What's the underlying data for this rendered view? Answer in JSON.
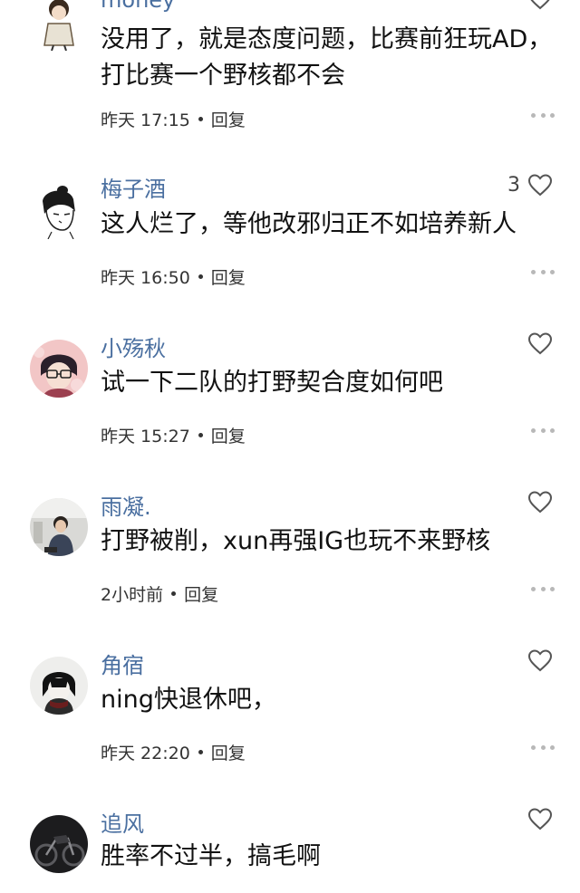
{
  "comments": [
    {
      "username": "money",
      "likes": "",
      "text": "没用了，就是态度问题，比赛前狂玩AD，打比赛一个野核都不会",
      "time": "昨天 17:15",
      "reply": "回复"
    },
    {
      "username": "梅子酒",
      "likes": "3",
      "text": "这人烂了，等他改邪归正不如培养新人",
      "time": "昨天 16:50",
      "reply": "回复"
    },
    {
      "username": "小殇秋",
      "likes": "",
      "text": "试一下二队的打野契合度如何吧",
      "time": "昨天 15:27",
      "reply": "回复"
    },
    {
      "username": "雨凝.",
      "likes": "",
      "text": "打野被削，xun再强IG也玩不来野核",
      "time": "2小时前",
      "reply": "回复"
    },
    {
      "username": "角宿",
      "likes": "",
      "text": "ning快退休吧，",
      "time": "昨天 22:20",
      "reply": "回复"
    },
    {
      "username": "追风",
      "likes": "",
      "text": "胜率不过半，搞毛啊",
      "time": "",
      "reply": ""
    }
  ]
}
